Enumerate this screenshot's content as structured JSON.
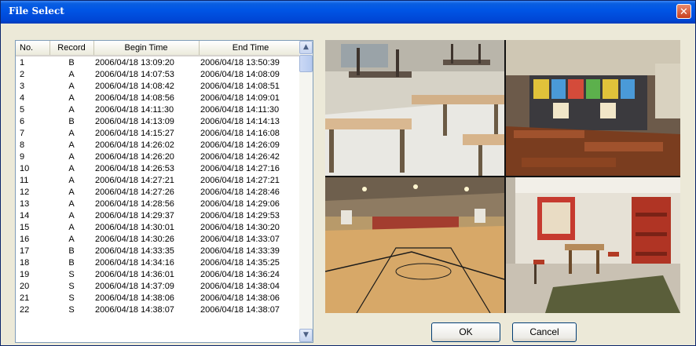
{
  "window": {
    "title": "File Select",
    "close_glyph": "✕"
  },
  "table": {
    "columns": [
      "No.",
      "Record",
      "Begin Time",
      "End Time"
    ],
    "rows": [
      [
        "1",
        "B",
        "2006/04/18 13:09:20",
        "2006/04/18 13:50:39"
      ],
      [
        "2",
        "A",
        "2006/04/18 14:07:53",
        "2006/04/18 14:08:09"
      ],
      [
        "3",
        "A",
        "2006/04/18 14:08:42",
        "2006/04/18 14:08:51"
      ],
      [
        "4",
        "A",
        "2006/04/18 14:08:56",
        "2006/04/18 14:09:01"
      ],
      [
        "5",
        "A",
        "2006/04/18 14:11:30",
        "2006/04/18 14:11:30"
      ],
      [
        "6",
        "B",
        "2006/04/18 14:13:09",
        "2006/04/18 14:14:13"
      ],
      [
        "7",
        "A",
        "2006/04/18 14:15:27",
        "2006/04/18 14:16:08"
      ],
      [
        "8",
        "A",
        "2006/04/18 14:26:02",
        "2006/04/18 14:26:09"
      ],
      [
        "9",
        "A",
        "2006/04/18 14:26:20",
        "2006/04/18 14:26:42"
      ],
      [
        "10",
        "A",
        "2006/04/18 14:26:53",
        "2006/04/18 14:27:16"
      ],
      [
        "11",
        "A",
        "2006/04/18 14:27:21",
        "2006/04/18 14:27:21"
      ],
      [
        "12",
        "A",
        "2006/04/18 14:27:26",
        "2006/04/18 14:28:46"
      ],
      [
        "13",
        "A",
        "2006/04/18 14:28:56",
        "2006/04/18 14:29:06"
      ],
      [
        "14",
        "A",
        "2006/04/18 14:29:37",
        "2006/04/18 14:29:53"
      ],
      [
        "15",
        "A",
        "2006/04/18 14:30:01",
        "2006/04/18 14:30:20"
      ],
      [
        "16",
        "A",
        "2006/04/18 14:30:26",
        "2006/04/18 14:33:07"
      ],
      [
        "17",
        "B",
        "2006/04/18 14:33:35",
        "2006/04/18 14:33:39"
      ],
      [
        "18",
        "B",
        "2006/04/18 14:34:16",
        "2006/04/18 14:35:25"
      ],
      [
        "19",
        "S",
        "2006/04/18 14:36:01",
        "2006/04/18 14:36:24"
      ],
      [
        "20",
        "S",
        "2006/04/18 14:37:09",
        "2006/04/18 14:38:04"
      ],
      [
        "21",
        "S",
        "2006/04/18 14:38:06",
        "2006/04/18 14:38:06"
      ],
      [
        "22",
        "S",
        "2006/04/18 14:38:07",
        "2006/04/18 14:38:07"
      ]
    ]
  },
  "scrollbar": {
    "up_glyph": "▲",
    "down_glyph": "▼"
  },
  "preview": {
    "cameras": [
      "lab-classroom",
      "art-classroom",
      "gymnasium",
      "kindergarten-room"
    ]
  },
  "buttons": {
    "ok": "OK",
    "cancel": "Cancel"
  },
  "colors": {
    "titlebar": "#0054e3",
    "close": "#d8502a",
    "dialog_bg": "#ece9d8",
    "list_border": "#7f9db9"
  }
}
